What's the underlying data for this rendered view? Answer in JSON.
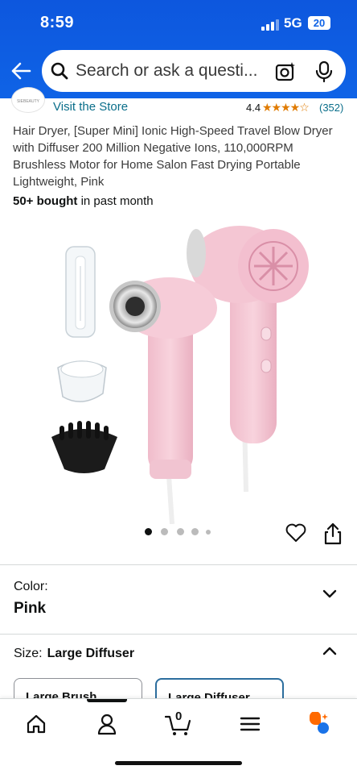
{
  "status": {
    "time": "8:59",
    "network": "5G",
    "battery": "20"
  },
  "search": {
    "placeholder": "Search or ask a questi..."
  },
  "store": {
    "link": "Visit the Store",
    "logo_text": "SIEBEAUTY",
    "rating": "4.4",
    "stars": "★★★★☆",
    "rating_count": "(352)"
  },
  "product": {
    "title": "Hair Dryer, [Super Mini] Ionic High-Speed Travel Blow Dryer with Diffuser 200 Million Negative Ions, 110,000RPM Brushless Motor for Home Salon Fast Drying Portable Lightweight, Pink",
    "bought_strong": "50+ bought",
    "bought_rest": " in past month",
    "image_count": 5,
    "active_image": 0
  },
  "color": {
    "label": "Color:",
    "value": "Pink"
  },
  "size": {
    "label": "Size:",
    "value": "Large Diffuser",
    "options": [
      "Large Brush",
      "Large Diffuser"
    ],
    "selected": 1
  },
  "nav": {
    "items": [
      "home-icon",
      "account-icon",
      "cart-icon",
      "menu-icon",
      "rufus-icon"
    ],
    "active": 1,
    "cart_count": "0"
  },
  "colors": {
    "header": "#0f63e6",
    "link": "#0a6e8a",
    "star": "#e07b00",
    "selected_border": "#2c6e9e",
    "product_pink": "#f5c9d4"
  }
}
